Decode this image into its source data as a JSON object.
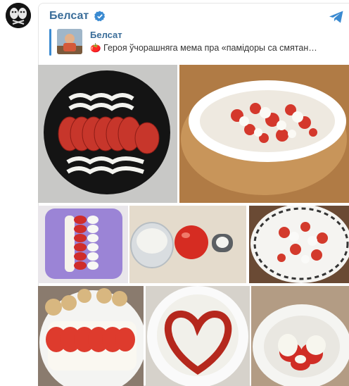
{
  "post": {
    "channel_name": "Белсат",
    "verified_icon": "verified-badge-icon",
    "share_icon": "telegram-share-icon"
  },
  "reply": {
    "name": "Белсат",
    "text": "🍅 Героя ўчорашняга мема пра «памідоры са смятан…"
  },
  "colors": {
    "channel_name": "#3a6d99",
    "reply_bar": "#3a8ad1",
    "verified": "#3a8ad1"
  },
  "photos": [
    "black-plate-tomatoes-cream-photo",
    "bowl-tomato-cream-salad-photo",
    "purple-plate-tomato-stripe-photo",
    "tomato-cream-bowl-still-life-photo",
    "patterned-plate-salad-photo",
    "cottage-cheese-tomato-plate-photo",
    "ketchup-heart-plate-photo",
    "bowl-cream-tomato-closeup-photo"
  ]
}
